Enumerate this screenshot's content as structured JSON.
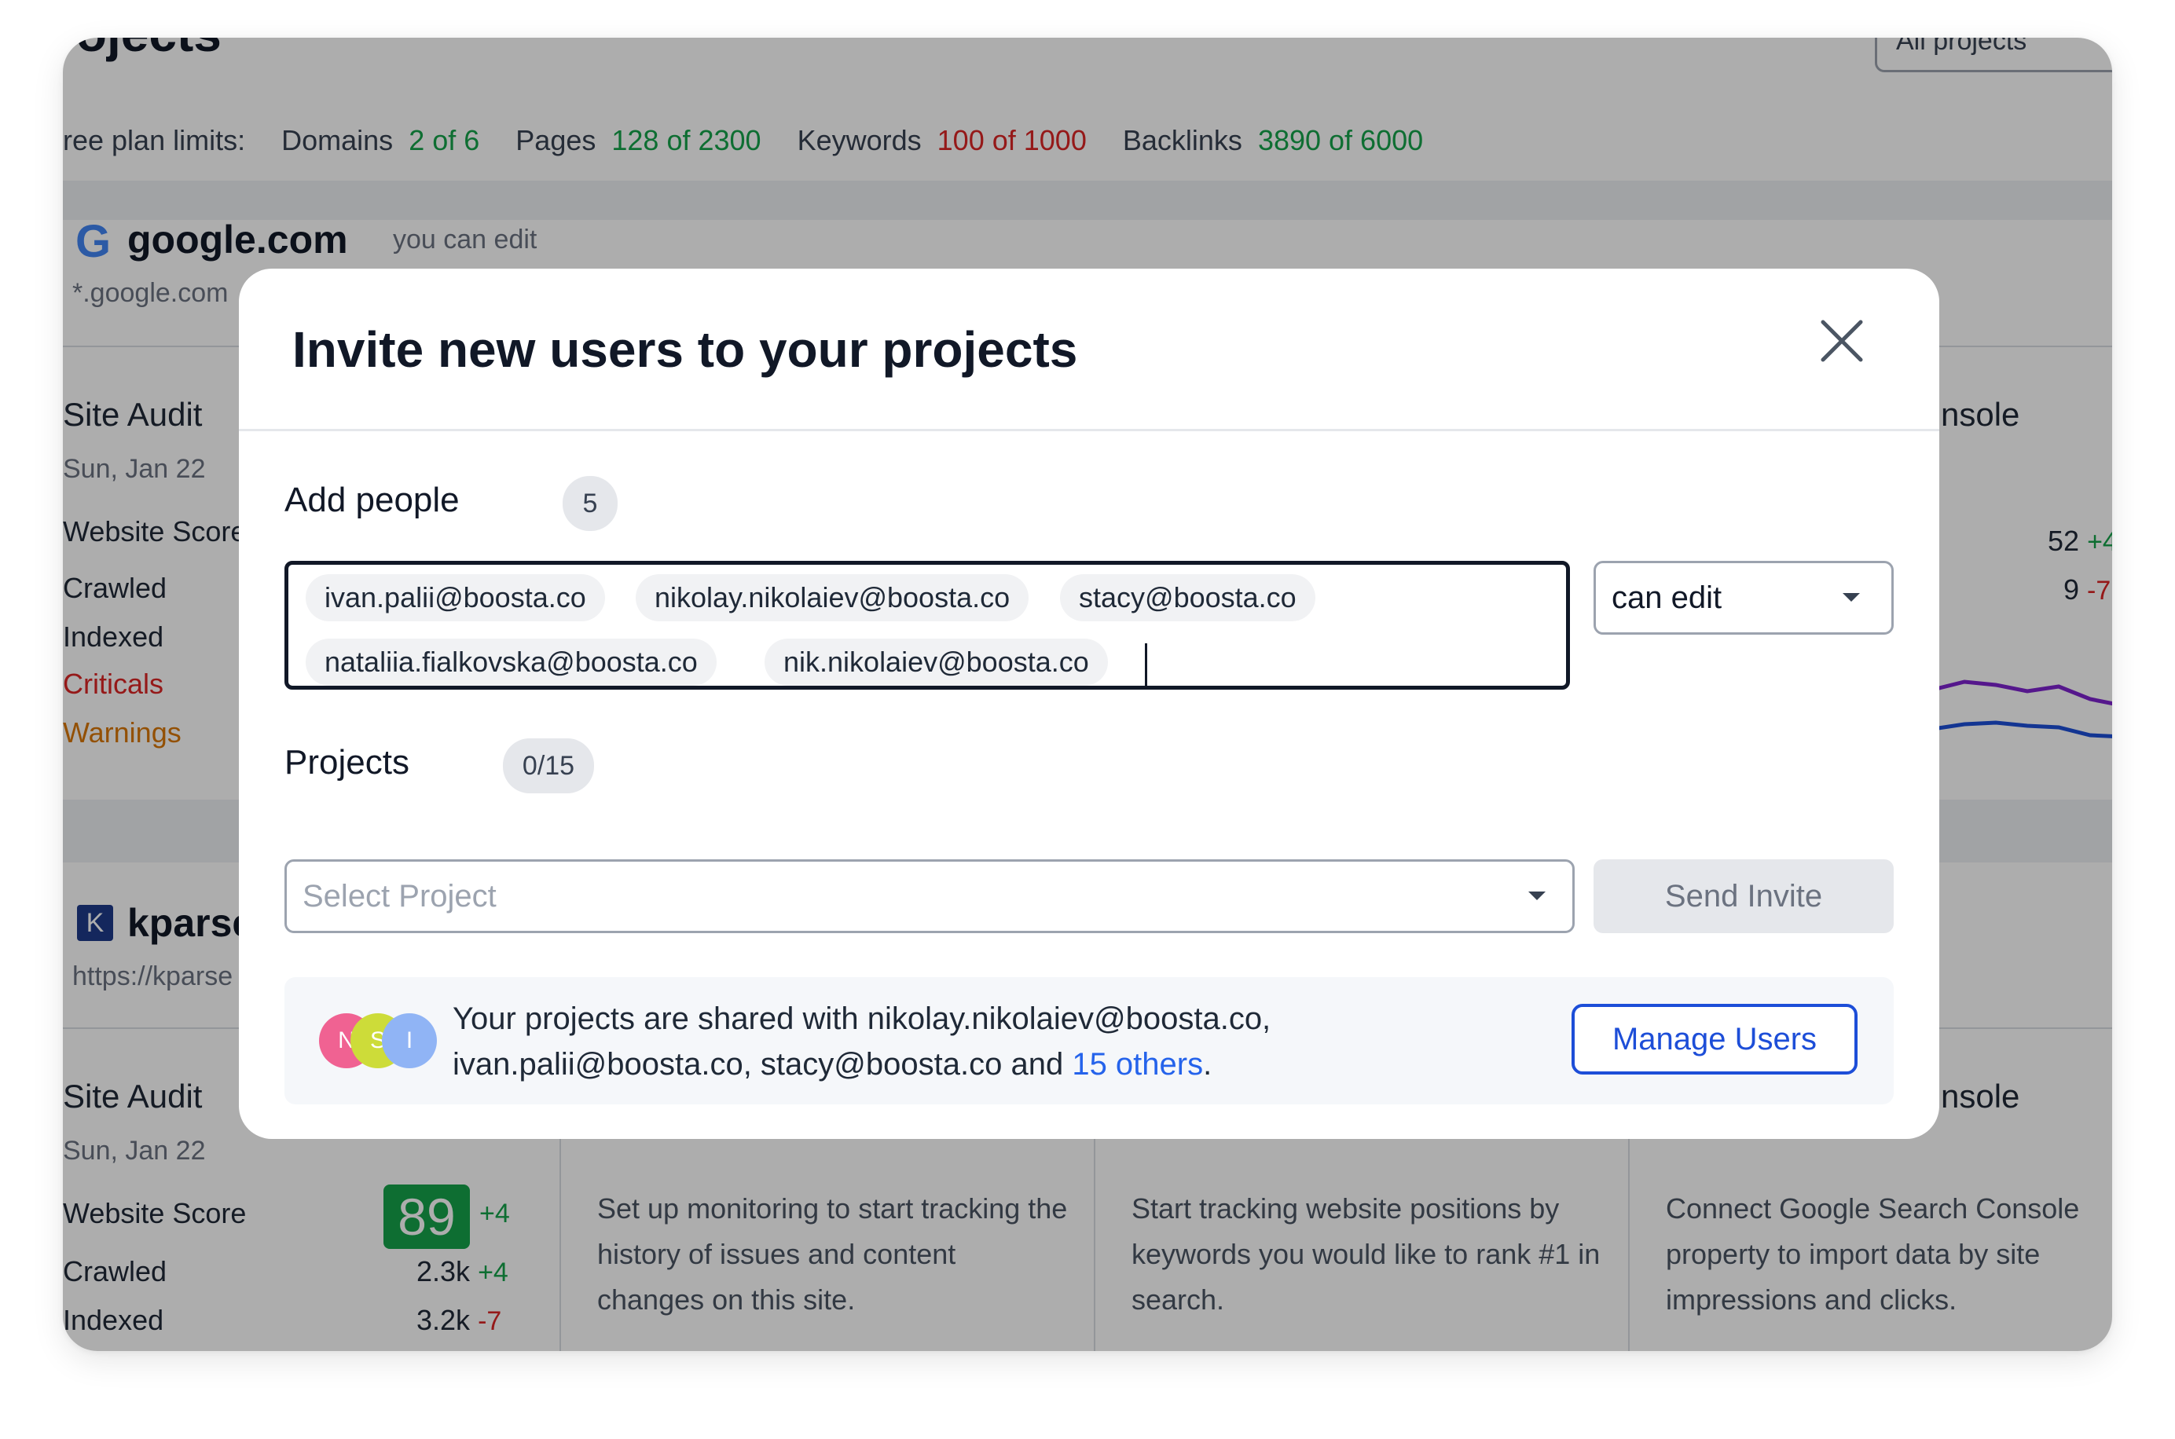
{
  "background": {
    "page_title": "rojects",
    "all_projects_label": "All projects",
    "limits": {
      "label": "ree plan limits:",
      "domains_label": "Domains",
      "domains_value": "2 of 6",
      "pages_label": "Pages",
      "pages_value": "128 of 2300",
      "keywords_label": "Keywords",
      "keywords_value": "100 of 1000",
      "backlinks_label": "Backlinks",
      "backlinks_value": "3890 of 6000"
    },
    "project1": {
      "logo_letter": "G",
      "domain": "google.com",
      "permission": "you can edit",
      "subdomain": "*.google.com",
      "site_audit_title": "Site Audit",
      "date": "Sun, Jan 22",
      "stats": [
        "Website Score",
        "Crawled",
        "Indexed",
        "Criticals",
        "Warnings"
      ],
      "console_title": "nsole",
      "console_values": [
        {
          "value": "52",
          "delta": "+4"
        },
        {
          "value": "9",
          "delta": "-7"
        }
      ]
    },
    "project2": {
      "logo_letter": "K",
      "domain": "kparse",
      "url": "https://kparse",
      "site_audit_title": "Site Audit",
      "date": "Sun, Jan 22",
      "website_score_label": "Website Score",
      "score": "89",
      "score_delta": "+4",
      "crawled_label": "Crawled",
      "crawled_value": "2.3k",
      "crawled_delta": "+4",
      "indexed_label": "Indexed",
      "indexed_value": "3.2k",
      "indexed_delta": "-7",
      "monitoring_desc": "Set up monitoring to start tracking the history of issues and content changes on this site.",
      "tracking_desc": "Start tracking website positions by keywords you would like to rank #1 in search.",
      "console_desc": "Connect Google Search Console property to import data by site impressions and clicks.",
      "console_title": "nsole"
    }
  },
  "modal": {
    "title": "Invite new users to your projects",
    "close_icon": "close-icon",
    "add_people_label": "Add people",
    "add_people_count": "5",
    "emails": [
      "ivan.palii@boosta.co",
      "nikolay.nikolaiev@boosta.co",
      "stacy@boosta.co",
      "nataliia.fialkovska@boosta.co",
      "nik.nikolaiev@boosta.co"
    ],
    "permission_value": "can edit",
    "projects_label": "Projects",
    "projects_count": "0/15",
    "select_placeholder": "Select Project",
    "send_button": "Send Invite",
    "info": {
      "avatars": [
        {
          "letter": "N",
          "color": "#f06292"
        },
        {
          "letter": "S",
          "color": "#cddc39"
        },
        {
          "letter": "I",
          "color": "#90b4f5"
        }
      ],
      "line1": "Your projects are shared with nikolay.nikolaiev@boosta.co,",
      "line2_prefix": "ivan.palii@boosta.co, stacy@boosta.co and ",
      "others_link": "15 others",
      "line2_suffix": ".",
      "manage_button": "Manage Users"
    }
  },
  "colors": {
    "accent": "#1d4ed8",
    "positive": "#16a34a",
    "negative": "#dc2626",
    "warning": "#d97706"
  }
}
